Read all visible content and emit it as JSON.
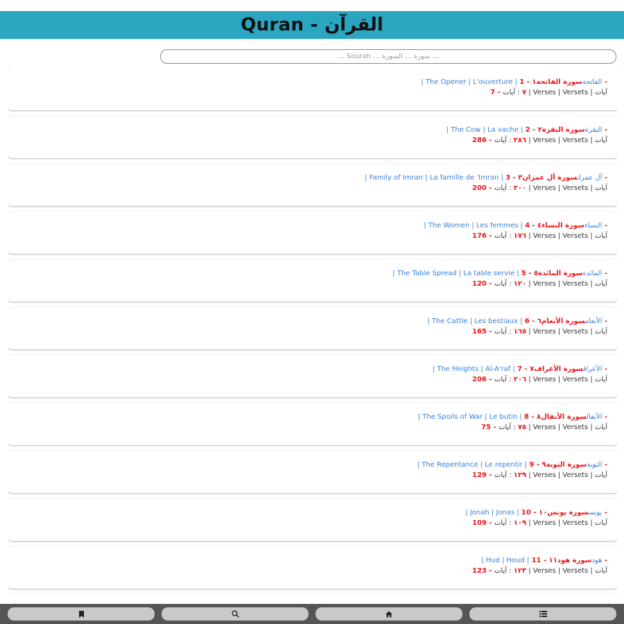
{
  "header": {
    "title": "Quran - القرآن"
  },
  "search": {
    "placeholder": "... Sourah ... سورة ... السورة ..."
  },
  "verses_label": "آيات | Verses | Versets | آيات",
  "surahs": [
    {
      "num": "١ - 1 - ",
      "arabic": "سورة الفاتحة",
      "names": " | The Opener | L'ouverture | الفاتحة",
      "count": "7 - ٧"
    },
    {
      "num": "٢ - 2 - ",
      "arabic": "سورة البقرة",
      "names": " | The Cow | La vache | البقرة",
      "count": "286 - ٢٨٦"
    },
    {
      "num": "٣ - 3 - ",
      "arabic": "سورة آل عمران",
      "names": " | Family of Imran | La famille de 'Imran | آل عمران",
      "count": "200 - ٢٠٠"
    },
    {
      "num": "٤ - 4 - ",
      "arabic": "سورة النساء",
      "names": " | The Women | Les femmes | النساء",
      "count": "176 - ١٧٦"
    },
    {
      "num": "٥ - 5 - ",
      "arabic": "سورة المائدة",
      "names": " | The Table Spread | La table servie | المائدة",
      "count": "120 - ١٢٠"
    },
    {
      "num": "٦ - 6 - ",
      "arabic": "سورة الأنعام",
      "names": " | The Cattle | Les bestiaux | الأنعام",
      "count": "165 - ١٦٥"
    },
    {
      "num": "٧ - 7 - ",
      "arabic": "سورة الأعراف",
      "names": " | The Heights | Al-A'raf | الأعراف",
      "count": "206 - ٢٠٦"
    },
    {
      "num": "٨ - 8 - ",
      "arabic": "سورة الأنفال",
      "names": " | The Spoils of War | Le butin | الأنفال",
      "count": "75 - ٧٥"
    },
    {
      "num": "٩ - 9 - ",
      "arabic": "سورة التوبة",
      "names": " | The Repentance | Le repentir | التوبة",
      "count": "129 - ١٢٩"
    },
    {
      "num": "١٠ - 10 - ",
      "arabic": "سورة يونس",
      "names": " | Jonah | Jonas | يونس",
      "count": "109 - ١٠٩"
    },
    {
      "num": "١١ - 11 - ",
      "arabic": "سورة هود",
      "names": " | Hud | Houd | هود",
      "count": "123 - ١٢٣"
    }
  ],
  "nav": [
    {
      "icon": "bookmark-icon"
    },
    {
      "icon": "search-icon"
    },
    {
      "icon": "home-icon"
    },
    {
      "icon": "list-icon"
    }
  ]
}
